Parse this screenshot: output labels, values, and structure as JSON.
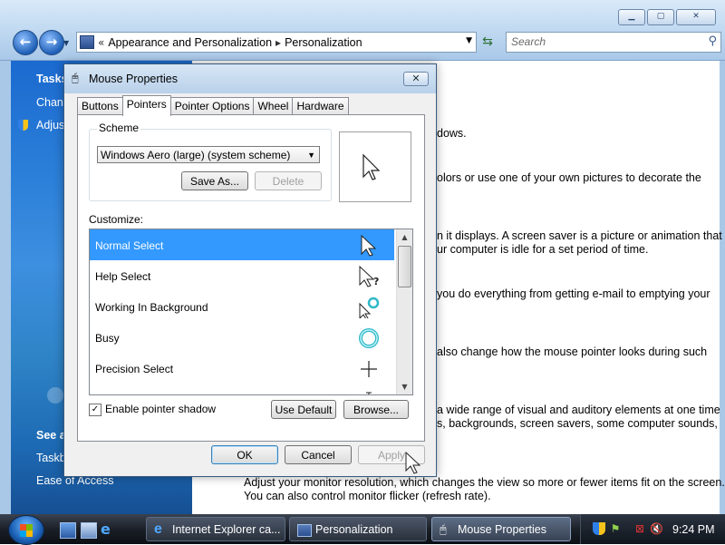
{
  "explorer": {
    "breadcrumb": [
      "Appearance and Personalization",
      "Personalization"
    ],
    "search_placeholder": "Search",
    "tasks_pane": {
      "tasks_header": "Tasks",
      "tasks_items": [
        "Chan",
        "Adjus"
      ],
      "see_also_header": "See a",
      "see_also_items": [
        "Taskb",
        "Ease of Access"
      ]
    },
    "content_lines": [
      "dows.",
      "olors or use one of your own pictures to decorate the",
      "n it displays. A screen saver is a picture or animation that",
      "ur computer is idle for a set period of time.",
      "you do everything from getting e-mail to emptying your",
      "also change how the mouse pointer looks during such",
      "a wide range of visual and auditory elements at one time",
      "s, backgrounds, screen savers, some computer sounds,",
      "Adjust your monitor resolution, which changes the view so more or fewer items fit on the screen.",
      "You can also control monitor flicker (refresh rate)."
    ]
  },
  "dialog": {
    "title": "Mouse Properties",
    "tabs": [
      "Buttons",
      "Pointers",
      "Pointer Options",
      "Wheel",
      "Hardware"
    ],
    "active_tab": "Pointers",
    "scheme_label": "Scheme",
    "scheme_value": "Windows Aero (large) (system scheme)",
    "save_as_label": "Save As...",
    "delete_label": "Delete",
    "customize_label": "Customize:",
    "cursor_list": [
      {
        "label": "Normal Select",
        "icon": "arrow-pointer-icon",
        "selected": true
      },
      {
        "label": "Help Select",
        "icon": "help-pointer-icon",
        "selected": false
      },
      {
        "label": "Working In Background",
        "icon": "working-background-pointer-icon",
        "selected": false
      },
      {
        "label": "Busy",
        "icon": "busy-ring-icon",
        "selected": false
      },
      {
        "label": "Precision Select",
        "icon": "crosshair-icon",
        "selected": false
      },
      {
        "label": "",
        "icon": "text-select-icon",
        "selected": false
      }
    ],
    "enable_shadow_label": "Enable pointer shadow",
    "enable_shadow_checked": true,
    "use_default_label": "Use Default",
    "browse_label": "Browse...",
    "ok_label": "OK",
    "cancel_label": "Cancel",
    "apply_label": "Apply"
  },
  "taskbar": {
    "buttons": [
      "Internet Explorer ca...",
      "Personalization",
      "Mouse Properties"
    ],
    "clock": "9:24 PM"
  },
  "colors": {
    "selection": "#3399ff",
    "tasks_pane": "#2b7fd8",
    "taskbar": "#1b2028"
  }
}
